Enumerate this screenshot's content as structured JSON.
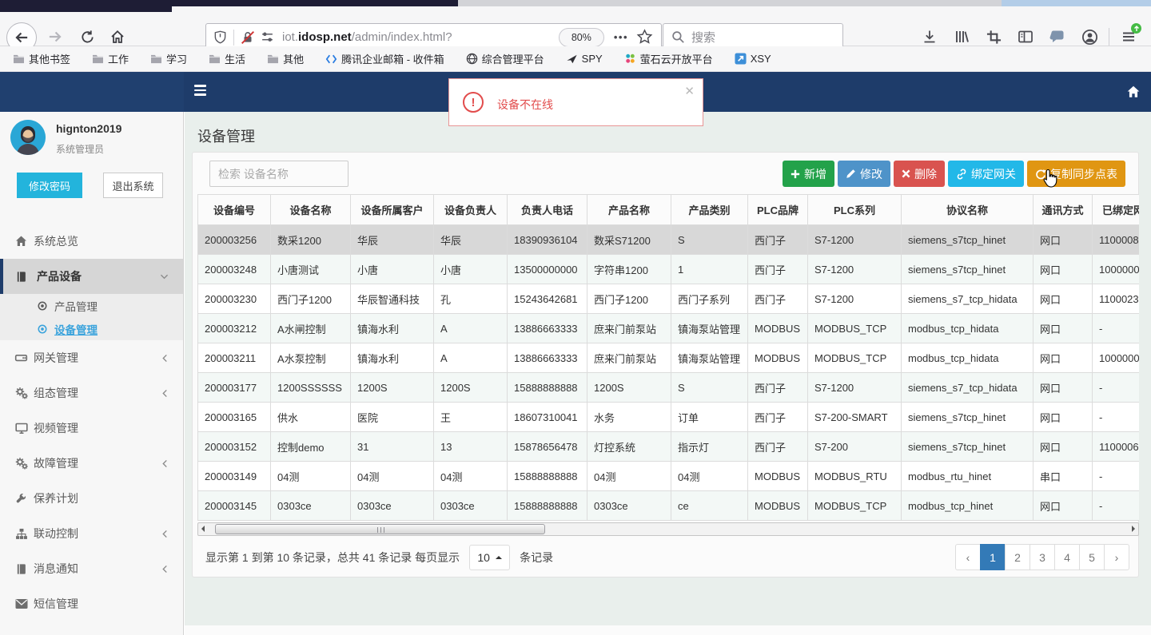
{
  "browser": {
    "nav": {
      "url_prefix": "iot.",
      "url_domain": "idosp.net",
      "url_path": "/admin/index.html?",
      "zoom_badge": "80%",
      "search_placeholder": "搜索"
    },
    "bookmarks": [
      {
        "icon": "folder-icon",
        "label": "其他书签"
      },
      {
        "icon": "folder-icon",
        "label": "工作"
      },
      {
        "icon": "folder-icon",
        "label": "学习"
      },
      {
        "icon": "folder-icon",
        "label": "生活"
      },
      {
        "icon": "folder-icon",
        "label": "其他"
      },
      {
        "icon": "tencent-mail-icon",
        "label": "腾讯企业邮箱 - 收件箱"
      },
      {
        "icon": "globe-icon",
        "label": "综合管理平台"
      },
      {
        "icon": "plane-icon",
        "label": "SPY"
      },
      {
        "icon": "ezviz-icon",
        "label": "萤石云开放平台"
      },
      {
        "icon": "xsy-icon",
        "label": "XSY"
      }
    ]
  },
  "alert": {
    "text": "设备不在线"
  },
  "sidebar": {
    "user": {
      "name": "hignton2019",
      "role": "系统管理员"
    },
    "change_password": "修改密码",
    "logout": "退出系统",
    "menu": [
      {
        "icon": "home-icon",
        "label": "系统总览"
      },
      {
        "icon": "book-icon",
        "label": "产品设备",
        "chevron": "down",
        "active": true,
        "children": [
          {
            "icon": "circle-dot-icon",
            "label": "产品管理"
          },
          {
            "icon": "circle-dot-icon",
            "label": "设备管理",
            "active": true
          }
        ]
      },
      {
        "icon": "hdd-icon",
        "label": "网关管理",
        "chevron": "left"
      },
      {
        "icon": "cogs-icon",
        "label": "组态管理",
        "chevron": "left"
      },
      {
        "icon": "monitor-icon",
        "label": "视频管理"
      },
      {
        "icon": "cogs-icon",
        "label": "故障管理",
        "chevron": "left"
      },
      {
        "icon": "wrench-icon",
        "label": "保养计划"
      },
      {
        "icon": "sitemap-icon",
        "label": "联动控制",
        "chevron": "left"
      },
      {
        "icon": "book-icon",
        "label": "消息通知",
        "chevron": "left"
      },
      {
        "icon": "envelope-icon",
        "label": "短信管理"
      }
    ]
  },
  "main": {
    "title": "设备管理",
    "search_placeholder": "检索 设备名称",
    "toolbar": [
      {
        "icon": "plus-icon",
        "label": "新增",
        "color": "#23a24a"
      },
      {
        "icon": "pencil-icon",
        "label": "修改",
        "color": "#4e93c9"
      },
      {
        "icon": "x-icon",
        "label": "删除",
        "color": "#d9534f"
      },
      {
        "icon": "link-icon",
        "label": "绑定网关",
        "color": "#22b8e8"
      },
      {
        "icon": "refresh-icon",
        "label": "复制同步点表",
        "color": "#e09612"
      }
    ],
    "table": {
      "columns": [
        "设备编号",
        "设备名称",
        "设备所属客户",
        "设备负责人",
        "负责人电话",
        "产品名称",
        "产品类别",
        "PLC品牌",
        "PLC系列",
        "协议名称",
        "通讯方式",
        "已绑定网关"
      ],
      "rows": [
        [
          "200003256",
          "数采1200",
          "华辰",
          "华辰",
          "18390936104",
          "数采S71200",
          "S",
          "西门子",
          "S7-1200",
          "siemens_s7tcp_hinet",
          "网口",
          "1100008"
        ],
        [
          "200003248",
          "小唐测试",
          "小唐",
          "小唐",
          "13500000000",
          "字符串1200",
          "1",
          "西门子",
          "S7-1200",
          "siemens_s7tcp_hinet",
          "网口",
          "1000000"
        ],
        [
          "200003230",
          "西门子1200",
          "华辰智通科技",
          "孔",
          "15243642681",
          "西门子1200",
          "西门子系列",
          "西门子",
          "S7-1200",
          "siemens_s7_tcp_hidata",
          "网口",
          "1100023"
        ],
        [
          "200003212",
          "A水闸控制",
          "镇海水利",
          "A",
          "13886663333",
          "庶来门前泵站",
          "镇海泵站管理",
          "MODBUS",
          "MODBUS_TCP",
          "modbus_tcp_hidata",
          "网口",
          "-"
        ],
        [
          "200003211",
          "A水泵控制",
          "镇海水利",
          "A",
          "13886663333",
          "庶来门前泵站",
          "镇海泵站管理",
          "MODBUS",
          "MODBUS_TCP",
          "modbus_tcp_hidata",
          "网口",
          "1000000"
        ],
        [
          "200003177",
          "1200SSSSSS",
          "1200S",
          "1200S",
          "15888888888",
          "1200S",
          "S",
          "西门子",
          "S7-1200",
          "siemens_s7_tcp_hidata",
          "网口",
          "-"
        ],
        [
          "200003165",
          "供水",
          "医院",
          "王",
          "18607310041",
          "水务",
          "订单",
          "西门子",
          "S7-200-SMART",
          "siemens_s7tcp_hinet",
          "网口",
          "-"
        ],
        [
          "200003152",
          "控制demo",
          "31",
          "13",
          "15878656478",
          "灯控系统",
          "指示灯",
          "西门子",
          "S7-200",
          "siemens_s7tcp_hinet",
          "网口",
          "1100006"
        ],
        [
          "200003149",
          "04测",
          "04测",
          "04测",
          "15888888888",
          "04测",
          "04测",
          "MODBUS",
          "MODBUS_RTU",
          "modbus_rtu_hinet",
          "串口",
          "-"
        ],
        [
          "200003145",
          "0303ce",
          "0303ce",
          "0303ce",
          "15888888888",
          "0303ce",
          "ce",
          "MODBUS",
          "MODBUS_TCP",
          "modbus_tcp_hinet",
          "网口",
          "-"
        ]
      ],
      "selected_row": 0
    },
    "pagination": {
      "summary_prefix": "显示第 1 到第 10 条记录，总共 41 条记录 每页显示",
      "page_size": "10",
      "summary_suffix": "条记录",
      "pages": [
        "‹",
        "1",
        "2",
        "3",
        "4",
        "5",
        "›"
      ],
      "active_page": "1"
    }
  },
  "colors": {
    "header_navy": "#1e3c6a",
    "accent_blue": "#3aa3dc",
    "active_page_blue": "#337ab7",
    "alert_red": "#e24c4c"
  }
}
